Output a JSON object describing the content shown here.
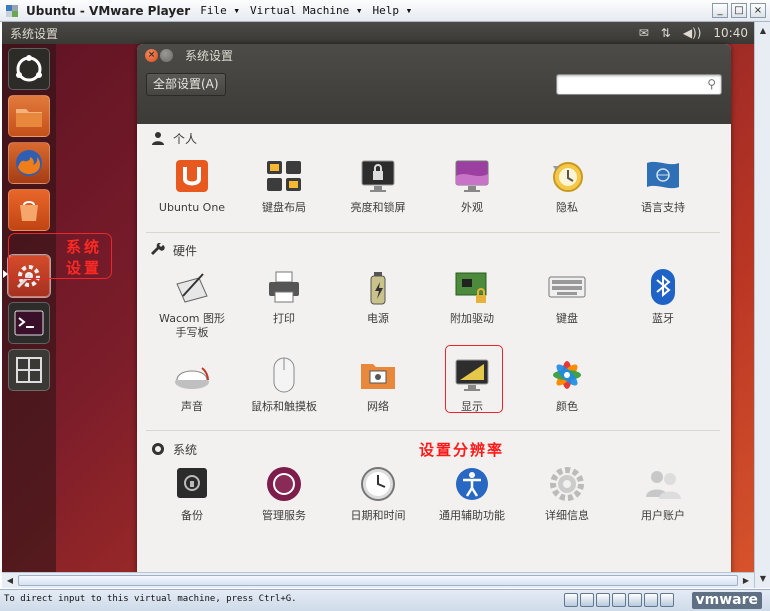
{
  "vmware": {
    "title": "Ubuntu - VMware Player",
    "menus": [
      "File ▾",
      "Virtual Machine ▾",
      "Help ▾"
    ],
    "controls": [
      "_",
      "□",
      "×"
    ],
    "status_text": "To direct input to this virtual machine, press Ctrl+G.",
    "brand": "vmware"
  },
  "ubuntu": {
    "panel_title": "系统设置",
    "clock": "10:40",
    "tray": [
      "✉",
      "⇅",
      "◀))"
    ],
    "launcher_annotation": [
      "系统",
      "设置"
    ]
  },
  "settings": {
    "window_title": "系统设置",
    "all_settings_button": "全部设置(A)",
    "search_placeholder": "",
    "sections": [
      {
        "title": "个人",
        "items": [
          "Ubuntu One",
          "键盘布局",
          "亮度和锁屏",
          "外观",
          "隐私",
          "语言支持"
        ]
      },
      {
        "title": "硬件",
        "items": [
          "Wacom 图形\n手写板",
          "打印",
          "电源",
          "附加驱动",
          "键盘",
          "蓝牙",
          "声音",
          "鼠标和触摸板",
          "网络",
          "显示",
          "颜色"
        ]
      },
      {
        "title": "系统",
        "items": [
          "备份",
          "管理服务",
          "日期和时间",
          "通用辅助功能",
          "详细信息",
          "用户账户"
        ]
      }
    ],
    "callout": "设置分辨率"
  },
  "colors": {
    "ubuntu_orange": "#dd4814",
    "annotation_red": "#e8262b",
    "panel_dark": "#3c3b37"
  }
}
